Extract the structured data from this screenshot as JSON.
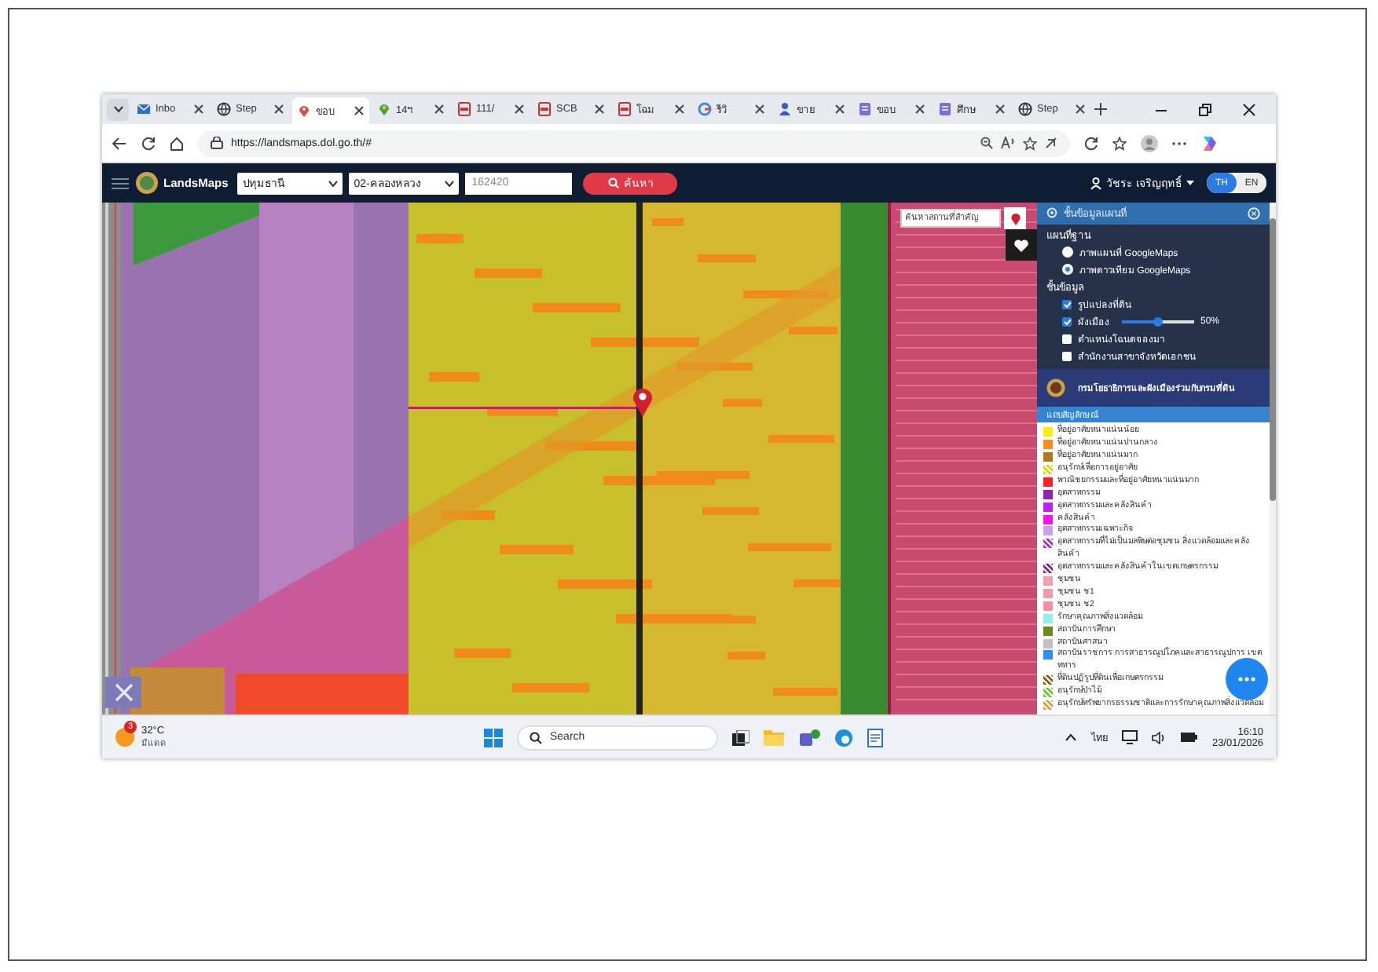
{
  "browser": {
    "tabs": [
      {
        "label": "Inbo",
        "kind": "mail",
        "selected": false
      },
      {
        "label": "Step",
        "kind": "globe",
        "selected": false
      },
      {
        "label": "ขอบ",
        "kind": "pin",
        "selected": true
      },
      {
        "label": "14ฯ",
        "kind": "maps",
        "selected": false
      },
      {
        "label": "111/",
        "kind": "pdf",
        "selected": false
      },
      {
        "label": "SCB",
        "kind": "pdf",
        "selected": false
      },
      {
        "label": "โฉม",
        "kind": "pdf",
        "selected": false
      },
      {
        "label": "รีวิ",
        "kind": "google",
        "selected": false
      },
      {
        "label": "ขาย",
        "kind": "person",
        "selected": false
      },
      {
        "label": "ขอบ",
        "kind": "doc",
        "selected": false
      },
      {
        "label": "ศึกษ",
        "kind": "doc",
        "selected": false
      },
      {
        "label": "Step",
        "kind": "globe",
        "selected": false
      }
    ],
    "address": "https://landsmaps.dol.go.th/#"
  },
  "app": {
    "logo_text": "LandsMaps",
    "province": "ปทุมธานี",
    "district": "02-คลองหลวง",
    "parcel": {
      "placeholder": "162420"
    },
    "search_button": "ค้นหา",
    "user": "วัชระ เจริญฤทธิ์",
    "languages": [
      {
        "label": "TH",
        "selected": true
      },
      {
        "label": "EN",
        "selected": false
      }
    ]
  },
  "map": {
    "place_search": {
      "placeholder": "ค้นหาสถานที่สำคัญ"
    }
  },
  "layers_panel": {
    "title": "ชั้นข้อมูลแผนที่",
    "base_map_heading": "แผนที่ฐาน",
    "base_maps": [
      {
        "label": "ภาพแผนที่ GoogleMaps",
        "selected": false
      },
      {
        "label": "ภาพดาวเทียม GoogleMaps",
        "selected": true
      }
    ],
    "layers_heading": "ชั้นข้อมูล",
    "layers": [
      {
        "kind": "checkbox",
        "label": "รูปแปลงที่ดิน",
        "checked": true
      },
      {
        "kind": "slider",
        "label": "ผังเมือง",
        "checked": true,
        "level": 0.5,
        "reading": "50%"
      },
      {
        "kind": "checkbox",
        "label": "ตำแหน่งโฉนดจองมา",
        "checked": false
      },
      {
        "kind": "checkbox",
        "label": "สำนักงานสาขาจังหวัดเอกชน",
        "checked": false
      }
    ],
    "banner": "กรมโยธาธิการและผังเมืองร่วมกับกรมที่ดิน",
    "legend_title": "แถบสัญลักษณ์",
    "legend": [
      {
        "label": "ที่อยู่อาศัยหนาแน่นน้อย",
        "color": "#ffee00",
        "kind": "solid"
      },
      {
        "label": "ที่อยู่อาศัยหนาแน่นปานกลาง",
        "color": "#ff8c1a",
        "kind": "solid"
      },
      {
        "label": "ที่อยู่อาศัยหนาแน่นมาก",
        "color": "#b07a1a",
        "kind": "solid"
      },
      {
        "label": "อนุรักษ์เพื่อการอยู่อาศัย",
        "color": "#e6d600",
        "kind": "hatched"
      },
      {
        "label": "พาณิชยกรรมและที่อยู่อาศัยหนาแน่นมาก",
        "color": "#ff2020",
        "kind": "solid"
      },
      {
        "label": "อุตสาหกรรม",
        "color": "#9a1fb0",
        "kind": "solid"
      },
      {
        "label": "อุตสาหกรรมและคลังสินค้า",
        "color": "#c020f0",
        "kind": "solid"
      },
      {
        "label": "คลังสินค้า",
        "color": "#ff10e8",
        "kind": "solid"
      },
      {
        "label": "อุตสาหกรรมเฉพาะกิจ",
        "color": "#c8a0f0",
        "kind": "solid"
      },
      {
        "label": "อุตสาหกรรมที่ไม่เป็นมลพิษต่อชุมชน สิ่งแวดล้อมและคลังสินค้า",
        "color": "#b030e0",
        "kind": "hatched"
      },
      {
        "label": "อุตสาหกรรมและคลังสินค้าในเขตเกษตรกรรม",
        "color": "#8a2a8a",
        "kind": "hatched"
      },
      {
        "label": "ชุมชน",
        "color": "#f4a0a8",
        "kind": "solid"
      },
      {
        "label": "ชุมชน ช1",
        "color": "#f49aa6",
        "kind": "solid"
      },
      {
        "label": "ชุมชน ช2",
        "color": "#f28f9e",
        "kind": "solid"
      },
      {
        "label": "รักษาคุณภาพสิ่งแวดล้อม",
        "color": "#90f0f0",
        "kind": "solid"
      },
      {
        "label": "สถาบันการศึกษา",
        "color": "#6a8a1a",
        "kind": "solid"
      },
      {
        "label": "สถาบันศาสนา",
        "color": "#c0c0c0",
        "kind": "solid"
      },
      {
        "label": "สถาบันราชการ การสาธารณูปโภคและสาธารณูปการ เขตทหาร",
        "color": "#2e8ff0",
        "kind": "solid"
      },
      {
        "label": "ที่ดินปฏิรูปที่ดินเพื่อเกษตรกรรม",
        "color": "#8a6a10",
        "kind": "hatched"
      },
      {
        "label": "อนุรักษ์ป่าไม้",
        "color": "#70d020",
        "kind": "hatched"
      },
      {
        "label": "อนุรักษ์ทรัพยากรธรรมชาติและการรักษาคุณภาพสิ่งแวดล้อม",
        "color": "#e0a040",
        "kind": "hatched"
      }
    ]
  },
  "taskbar": {
    "weather": {
      "temperature": "32°C",
      "condition": "มีแดด",
      "badge": "3"
    },
    "search": {
      "placeholder": "Search"
    },
    "language": "ไทย",
    "time": "16:10",
    "date": "23/01/2026"
  }
}
